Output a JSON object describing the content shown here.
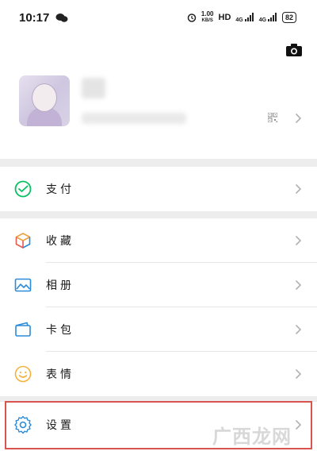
{
  "status_bar": {
    "time": "10:17",
    "speed_value": "1.00",
    "speed_unit": "KB/S",
    "hd": "HD",
    "signal_1": "4G",
    "signal_2": "4G",
    "battery": "82"
  },
  "menu": {
    "pay": "支付",
    "favorites": "收藏",
    "album": "相册",
    "cards": "卡包",
    "stickers": "表情",
    "settings": "设置"
  },
  "watermark": "广西龙网",
  "colors": {
    "pay_icon": "#07c160",
    "album_icon": "#2b8bd8",
    "settings_icon": "#2b8bd8",
    "stickers_icon": "#f5b23b",
    "highlight": "#d9534f"
  }
}
